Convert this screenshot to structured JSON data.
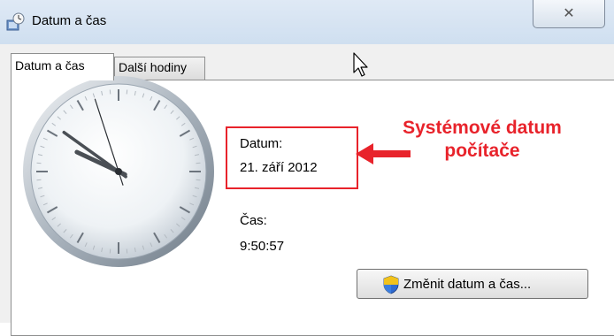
{
  "window": {
    "title": "Datum a čas",
    "close_glyph": "✕",
    "title_icon": "control-panel-clock-icon"
  },
  "tabs": [
    {
      "label": "Datum a čas",
      "active": true
    },
    {
      "label": "Další hodiny",
      "active": false
    }
  ],
  "clock": {
    "hours": 9,
    "minutes": 50,
    "seconds": 57
  },
  "date": {
    "label": "Datum:",
    "value": "21. září 2012"
  },
  "time": {
    "label": "Čas:",
    "value": "9:50:57"
  },
  "annotation": {
    "line1": "Systémové datum",
    "line2": "počítače",
    "color": "#e8232b"
  },
  "change_button": {
    "label": "Změnit datum a čas...",
    "icon": "uac-shield-icon"
  }
}
